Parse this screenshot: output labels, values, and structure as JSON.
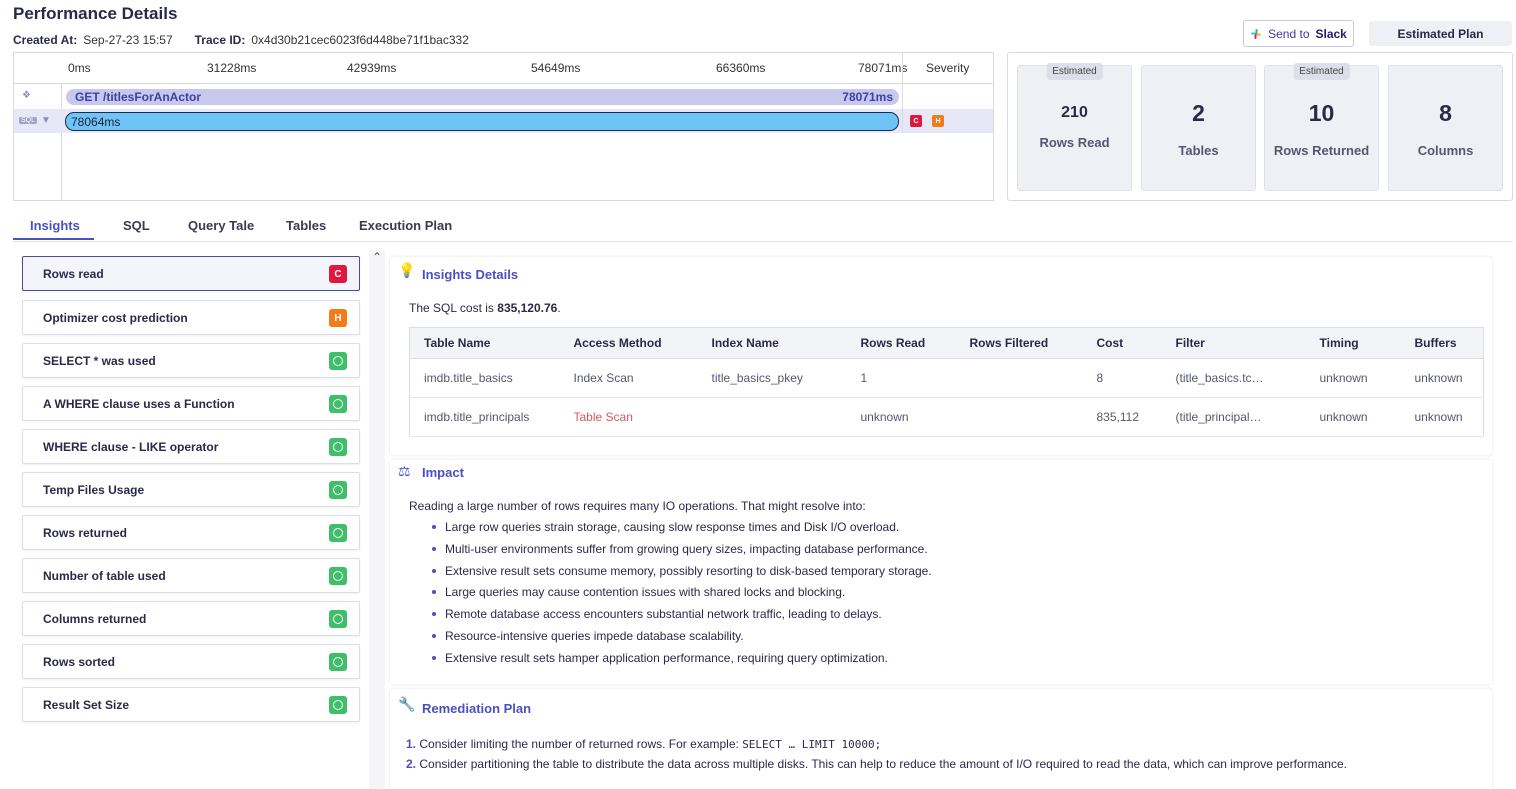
{
  "header": {
    "title": "Performance Details",
    "created_label": "Created At:",
    "created_value": "Sep-27-23 15:57",
    "trace_label": "Trace ID:",
    "trace_value": "0x4d30b21cec6023f6d448be71f1bac332",
    "slack_prefix": "Send to",
    "slack_brand": "Slack",
    "estimated_plan": "Estimated Plan"
  },
  "timeline": {
    "ticks": [
      "0ms",
      "31228ms",
      "42939ms",
      "54649ms",
      "66360ms",
      "78071ms"
    ],
    "severity_header": "Severity",
    "row1_label": "GET /titlesForAnActor",
    "row1_duration": "78071ms",
    "row1_progress": 1.0,
    "row2_label": "78064ms",
    "row2_progress": 1.0,
    "row2_badges": [
      "C",
      "H"
    ]
  },
  "stats": [
    {
      "tag": "Estimated",
      "value": "210",
      "label": "Rows Read"
    },
    {
      "tag": "",
      "value": "2",
      "label": "Tables"
    },
    {
      "tag": "Estimated",
      "value": "10",
      "label": "Rows Returned"
    },
    {
      "tag": "",
      "value": "8",
      "label": "Columns"
    }
  ],
  "tabs": [
    "Insights",
    "SQL",
    "Query Tale",
    "Tables",
    "Execution Plan"
  ],
  "insights": [
    {
      "label": "Rows read",
      "severity": "C"
    },
    {
      "label": "Optimizer cost prediction",
      "severity": "H"
    },
    {
      "label": "SELECT * was used",
      "severity": "ok"
    },
    {
      "label": "A WHERE clause uses a Function",
      "severity": "ok"
    },
    {
      "label": "WHERE clause - LIKE operator",
      "severity": "ok"
    },
    {
      "label": "Temp Files Usage",
      "severity": "ok"
    },
    {
      "label": "Rows returned",
      "severity": "ok"
    },
    {
      "label": "Number of table used",
      "severity": "ok"
    },
    {
      "label": "Columns returned",
      "severity": "ok"
    },
    {
      "label": "Rows sorted",
      "severity": "ok"
    },
    {
      "label": "Result Set Size",
      "severity": "ok"
    }
  ],
  "insights_details": {
    "title": "Insights Details",
    "cost_prefix": "The SQL cost is",
    "cost_value": "835,120.76",
    "cost_suffix": ".",
    "columns": [
      "Table Name",
      "Access Method",
      "Index Name",
      "Rows Read",
      "Rows Filtered",
      "Cost",
      "Filter",
      "Timing",
      "Buffers"
    ],
    "rows": [
      [
        "imdb.title_basics",
        "Index Scan",
        "title_basics_pkey",
        "1",
        "",
        "8",
        "(title_basics.tc…",
        "unknown",
        "unknown"
      ],
      [
        "imdb.title_principals",
        "Table Scan",
        "",
        "unknown",
        "",
        "835,112",
        "(title_principal…",
        "unknown",
        "unknown"
      ]
    ]
  },
  "impact": {
    "title": "Impact",
    "intro": "Reading a large number of rows requires many IO operations. That might resolve into:",
    "bullets": [
      "Large row queries strain storage, causing slow response times and Disk I/O overload.",
      "Multi-user environments suffer from growing query sizes, impacting database performance.",
      "Extensive result sets consume memory, possibly resorting to disk-based temporary storage.",
      "Large queries may cause contention issues with shared locks and blocking.",
      "Remote database access encounters substantial network traffic, leading to delays.",
      "Resource-intensive queries impede database scalability.",
      "Extensive result sets hamper application performance, requiring query optimization."
    ]
  },
  "remediation": {
    "title": "Remediation Plan",
    "steps": [
      {
        "num": "1.",
        "text": "Consider limiting the number of returned rows. For example:",
        "code": "SELECT … LIMIT 10000;"
      },
      {
        "num": "2.",
        "text": "Consider partitioning the table to distribute the data across multiple disks. This can help to reduce the amount of I/O required to read the data, which can improve performance.",
        "code": ""
      }
    ]
  },
  "colors": {
    "accent": "#4a50c2",
    "critical": "#e0173e",
    "high": "#f07d1a",
    "ok": "#3fbf6a",
    "bar_http": "#c7c8ec",
    "bar_sql": "#6ec4f4"
  }
}
